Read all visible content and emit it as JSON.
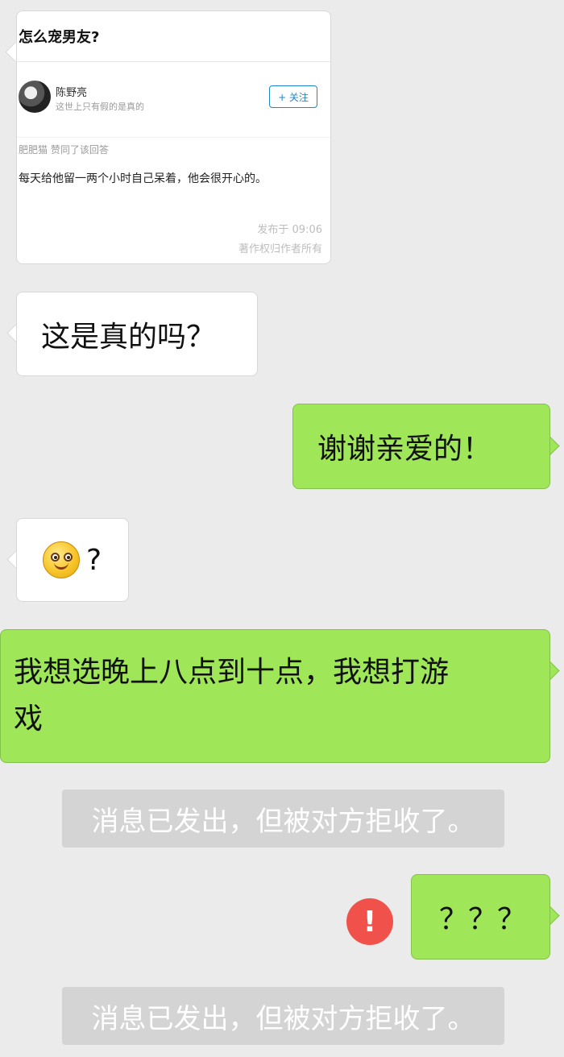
{
  "forwarded_card": {
    "title": "怎么宠男友?",
    "author_name": "陈野亮",
    "author_bio": "这世上只有假的是真的",
    "follow_label": "+ 关注",
    "liked_by": "肥肥猫 赞同了该回答",
    "answer_text": "每天给他留一两个小时自己呆着，他会很开心的。",
    "published": "发布于 09:06",
    "copyright": "著作权归作者所有"
  },
  "messages": [
    {
      "side": "left",
      "text": "这是真的吗？"
    },
    {
      "side": "right",
      "text": "谢谢亲爱的！"
    },
    {
      "side": "left",
      "emoji": "smiley-icon",
      "text": "?"
    },
    {
      "side": "right",
      "text_line1": "我想选晚上八点到十点，我想打游",
      "text_line2": "戏"
    },
    {
      "side": "system",
      "text": "消息已发出，但被对方拒收了。"
    },
    {
      "side": "right",
      "text": "？？？",
      "status": "failed",
      "status_symbol": "!"
    },
    {
      "side": "system",
      "text": "消息已发出，但被对方拒收了。"
    }
  ],
  "colors": {
    "background": "#ebebeb",
    "outgoing_bubble": "#9fe658",
    "incoming_bubble": "#ffffff",
    "system_notice": "#d4d4d4",
    "error_badge": "#f0524b",
    "follow_accent": "#1e88c7"
  }
}
